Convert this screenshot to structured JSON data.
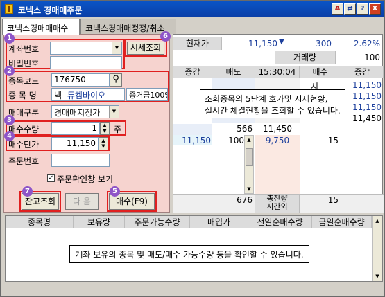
{
  "window": {
    "title": "코넥스 경매매주문"
  },
  "titlebar_buttons": [
    "A",
    "⇄",
    "?",
    "X"
  ],
  "tabs": [
    {
      "label": "코넥스경매매매수",
      "active": true
    },
    {
      "label": "코넥스경매매정정/취소",
      "active": false
    }
  ],
  "badges": [
    "1",
    "2",
    "3",
    "4",
    "5",
    "6",
    "7"
  ],
  "form": {
    "account_label": "계좌번호",
    "password_label": "비밀번호",
    "quote_button": "시세조회",
    "stock_code_label": "종목코드",
    "stock_code_value": "176750",
    "stock_name_label": "종 목 명",
    "stock_prefix": "넥",
    "stock_name_value": "듀켐바이오",
    "margin_value": "증거금100%",
    "trade_type_label": "매매구분",
    "trade_type_value": "경매매지정가",
    "qty_label": "매수수량",
    "qty_value": "1",
    "qty_unit": "주",
    "price_label": "매수단가",
    "price_value": "11,150",
    "order_no_label": "주문번호",
    "confirm_label": "주문확인창 보기",
    "balance_button": "잔고조회",
    "next_button": "다 음",
    "buy_button": "매수(F9)"
  },
  "quote": {
    "current_price_label": "현재가",
    "current_price": "11,150",
    "change": "300",
    "change_rate": "-2.62%",
    "volume_label": "거래량",
    "volume": "100",
    "headers": [
      "증감",
      "매도",
      "15:30:04",
      "매수",
      "증감"
    ],
    "ask_prefix": "시",
    "right_column": [
      "11,150",
      "11,150",
      "11,150",
      "11,450"
    ],
    "row_566": {
      "sell": "566",
      "price": "11,450"
    },
    "row_mid": {
      "left": "11,150",
      "sell": "100",
      "price": "9,750",
      "buy": "15"
    },
    "total_row": {
      "sell": "676",
      "label_1": "총잔량",
      "label_2": "시간외",
      "buy": "15"
    },
    "info_text_1": "조회종목의 5단계 호가및 시세현황,",
    "info_text_2": "실시간 체결현황을 조회할 수 있습니다."
  },
  "holdings": {
    "headers": [
      "종목명",
      "보유량",
      "주문가능수량",
      "매입가",
      "전일순매수량",
      "금일순매수량"
    ],
    "info_text": "계좌 보유의 종목 및 매도/매수 가능수량 등을 확인할 수 있습니다."
  },
  "colors": {
    "title_bar": "#0a54c6",
    "left_panel": "#f6d3cf",
    "highlight_red": "#e02020",
    "badge_purple": "#8e55c8",
    "down_blue": "#1c3f9c"
  }
}
